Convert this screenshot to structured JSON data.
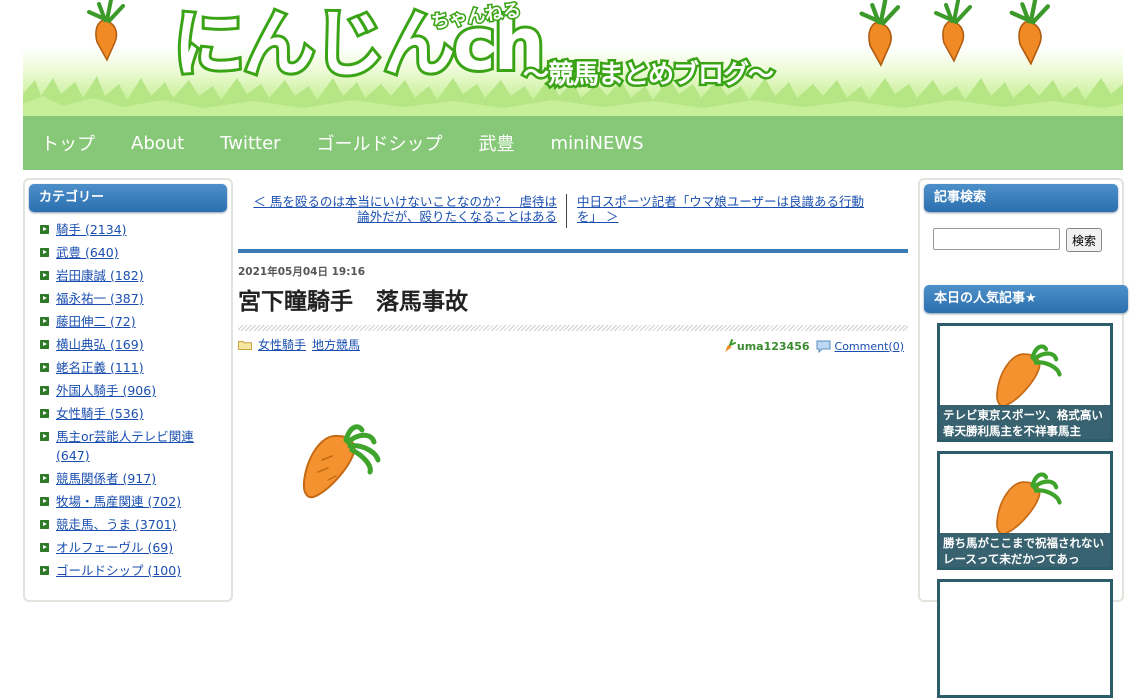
{
  "header": {
    "logo_main": "にんじんch",
    "logo_small": "ちゃんねる",
    "logo_subtitle": "～競馬まとめブログ～"
  },
  "nav": {
    "items": [
      "トップ",
      "About",
      "Twitter",
      "ゴールドシップ",
      "武豊",
      "miniNEWS"
    ],
    "background": "#86c877"
  },
  "left_sidebar": {
    "heading": "カテゴリー",
    "categories": [
      "騎手 (2134)",
      "武豊 (640)",
      "岩田康誠 (182)",
      "福永祐一 (387)",
      "藤田伸二 (72)",
      "横山典弘 (169)",
      "蛯名正義 (111)",
      "外国人騎手 (906)",
      "女性騎手 (536)",
      "馬主or芸能人テレビ関連 (647)",
      "競馬関係者 (917)",
      "牧場・馬産関連 (702)",
      "競走馬、うま (3701)",
      "オルフェーヴル (69)",
      "ゴールドシップ (100)"
    ]
  },
  "article": {
    "prev_link": "＜ 馬を殴るのは本当にいけないことなのか？　虐待は論外だが、殴りたくなることはある",
    "next_link": "中日スポーツ記者「ウマ娘ユーザーは良識ある行動を」 ＞",
    "date": "2021年05月04日 19:16",
    "title": "宮下瞳騎手　落馬事故",
    "tags": [
      "女性騎手",
      "地方競馬"
    ],
    "author": "uma123456",
    "comment_label": "Comment(0)",
    "accent": "#3a7ab5"
  },
  "right_sidebar": {
    "search_heading": "記事検索",
    "search_value": "",
    "search_button": "検索",
    "popular_heading": "本日の人気記事★",
    "popular": [
      {
        "caption": "テレビ東京スポーツ、格式高い春天勝利馬主を不祥事馬主"
      },
      {
        "caption": "勝ち馬がここまで祝福されないレースって未だかつてあっ"
      }
    ]
  },
  "icons": [
    "carrot-icon",
    "folder-icon",
    "author-carrot-icon",
    "comment-bubble-icon"
  ]
}
